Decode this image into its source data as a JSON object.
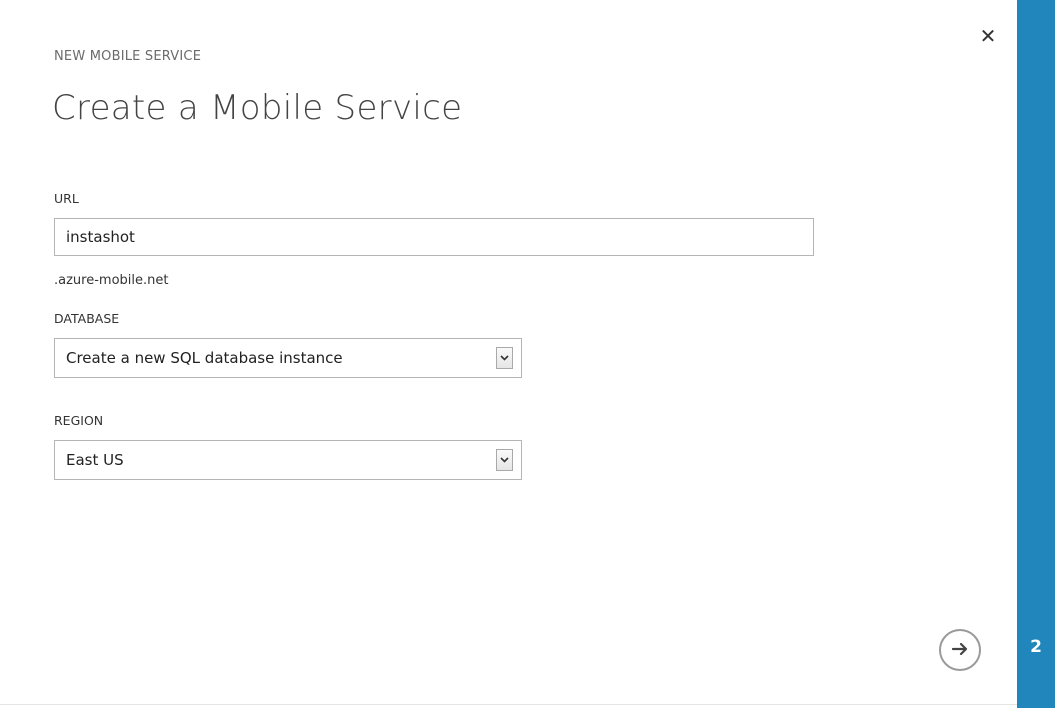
{
  "dialog": {
    "subtitle": "NEW MOBILE SERVICE",
    "title": "Create a Mobile Service",
    "close_icon": "close-icon",
    "step_number": "2",
    "next_icon": "arrow-right-icon",
    "accent_color": "#2186bb"
  },
  "form": {
    "url": {
      "label": "URL",
      "value": "instashot",
      "suffix": ".azure-mobile.net"
    },
    "database": {
      "label": "DATABASE",
      "selected": "Create a new SQL database instance"
    },
    "region": {
      "label": "REGION",
      "selected": "East US"
    }
  }
}
